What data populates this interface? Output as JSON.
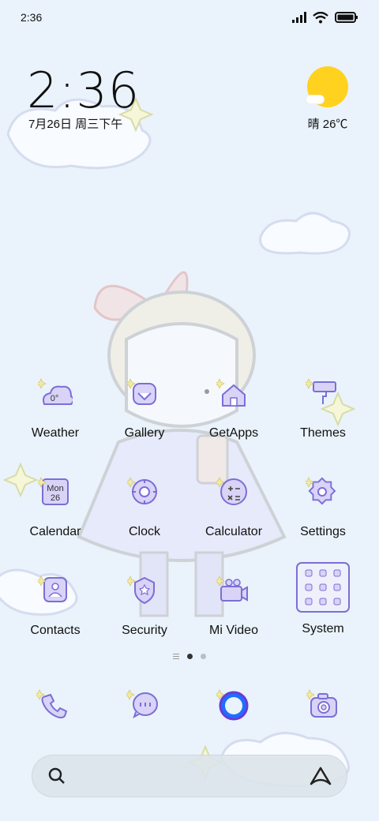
{
  "statusbar": {
    "time": "2:36"
  },
  "widget": {
    "time": "2:36",
    "date": "7月26日 周三下午",
    "weather": "晴 26℃"
  },
  "apps": [
    {
      "label": "Weather",
      "icon": "weather-icon",
      "badge": "0°"
    },
    {
      "label": "Gallery",
      "icon": "gallery-icon"
    },
    {
      "label": "GetApps",
      "icon": "getapps-icon"
    },
    {
      "label": "Themes",
      "icon": "themes-icon"
    },
    {
      "label": "Calendar",
      "icon": "calendar-icon",
      "badge_top": "Mon",
      "badge_bottom": "26"
    },
    {
      "label": "Clock",
      "icon": "clock-icon"
    },
    {
      "label": "Calculator",
      "icon": "calculator-icon"
    },
    {
      "label": "Settings",
      "icon": "settings-icon"
    },
    {
      "label": "Contacts",
      "icon": "contacts-icon"
    },
    {
      "label": "Security",
      "icon": "security-icon"
    },
    {
      "label": "Mi Video",
      "icon": "mi-video-icon"
    },
    {
      "label": "System",
      "icon": "system-folder-icon"
    }
  ],
  "dock": [
    "phone-icon",
    "messaging-icon",
    "browser-icon",
    "camera-icon"
  ],
  "pages": {
    "current": 1,
    "total": 2
  },
  "colors": {
    "accent": "#7a6fd6",
    "icon_fill": "#d9d3f7",
    "sun": "#ffd21f"
  }
}
